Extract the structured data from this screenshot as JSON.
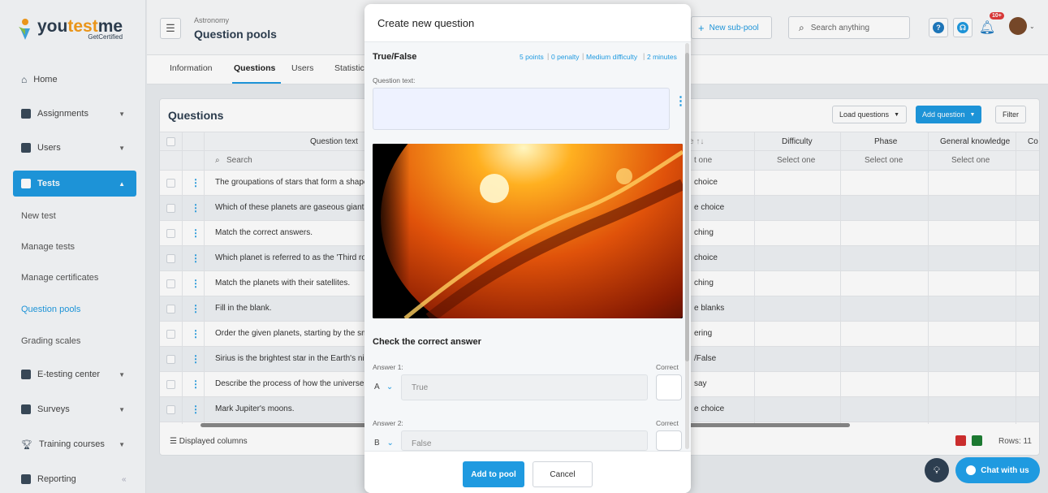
{
  "brand": {
    "name_a": "you",
    "name_b": "test",
    "name_c": "me",
    "sub": "GetCertified"
  },
  "sidebar": {
    "home": "Home",
    "assignments": "Assignments",
    "users": "Users",
    "tests": "Tests",
    "new_test": "New test",
    "manage_tests": "Manage tests",
    "manage_certificates": "Manage certificates",
    "question_pools": "Question pools",
    "grading_scales": "Grading scales",
    "etesting": "E-testing center",
    "surveys": "Surveys",
    "training": "Training courses",
    "reporting": "Reporting",
    "collapse": "«"
  },
  "header": {
    "crumb": "Astronomy",
    "title": "Question pools",
    "new_subpool": "New sub-pool",
    "search_placeholder": "Search anything",
    "notif_count": "10+"
  },
  "tabs": [
    "Information",
    "Questions",
    "Users",
    "Statistic"
  ],
  "questions_panel": {
    "title": "Questions",
    "load_questions": "Load questions",
    "add_question": "Add question",
    "filter": "Filter",
    "col_question_text": "Question text",
    "col_difficulty": "Difficulty",
    "col_phase": "Phase",
    "col_general": "General knowledge",
    "col_more": "Co",
    "type_sort": "e ↑↓",
    "search_label": "Search",
    "select_one": "Select one",
    "type_select": "t one",
    "rows": [
      {
        "text": "The groupations of stars that form a shape",
        "type": "choice"
      },
      {
        "text": "Which of these planets are gaseous giants?",
        "type": "e choice"
      },
      {
        "text": "Match the correct answers.",
        "type": "ching"
      },
      {
        "text": "Which planet is referred to as the 'Third roc",
        "type": "choice"
      },
      {
        "text": "Match the planets with their satellites.",
        "type": "ching"
      },
      {
        "text": "Fill in the blank.",
        "type": "e blanks"
      },
      {
        "text": "Order the given planets, starting by the sma",
        "type": "ering"
      },
      {
        "text": "Sirius is the brightest star in the Earth's nigh",
        "type": "/False"
      },
      {
        "text": "Describe the process of how the universe c",
        "type": "say"
      },
      {
        "text": "Mark Jupiter's moons.",
        "type": "e choice"
      }
    ],
    "displayed_columns": "Displayed columns",
    "rows_count": "Rows: 11"
  },
  "modal": {
    "title": "Create new question",
    "type": "True/False",
    "points": "5 points",
    "penalty": "0 penalty",
    "difficulty": "Medium difficulty",
    "time": "2 minutes",
    "question_text_label": "Question text:",
    "check_title": "Check the correct answer",
    "answers": [
      {
        "label": "Answer 1:",
        "letter": "A",
        "value": "True",
        "correct_label": "Correct"
      },
      {
        "label": "Answer 2:",
        "letter": "B",
        "value": "False",
        "correct_label": "Correct"
      }
    ],
    "add_to_pool": "Add to pool",
    "cancel": "Cancel"
  },
  "chat": {
    "label": "Chat with us"
  },
  "colors": {
    "accent": "#1f9ae0",
    "brand_orange": "#f49c1b",
    "dark": "#2d3e50"
  }
}
